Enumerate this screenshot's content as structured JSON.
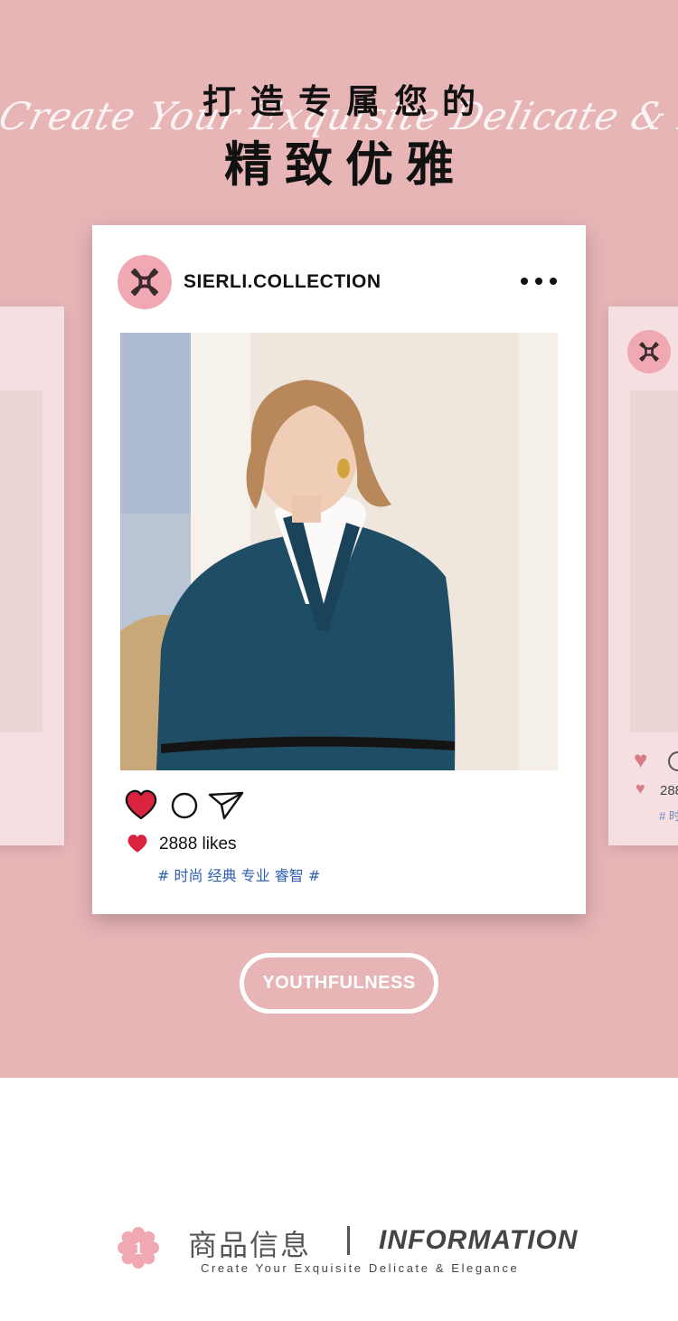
{
  "hero": {
    "script_text": "Create Your Exquisite Delicate & Elegance",
    "title_line1": "打造专属您的",
    "title_line2": "精致优雅",
    "background_color": "#e8b5b7"
  },
  "post": {
    "username": "SIERLI.COLLECTION",
    "more_icon": "ellipsis-icon",
    "photo_alt": "model in teal wool coat with black belt",
    "actions": {
      "like_icon": "heart-filled-icon",
      "comment_icon": "comment-circle-icon",
      "share_icon": "paper-plane-icon"
    },
    "likes_text": "2888 likes",
    "hashtags": "# 时尚 经典 专业 睿智 #",
    "like_color": "#d9233f",
    "hashtag_color": "#2d5fb0"
  },
  "ghost_card_right": {
    "likes_text": "288",
    "hashtag_text": "# 时"
  },
  "badge_button": {
    "label": "YOUTHFULNESS"
  },
  "section_header": {
    "number": "1",
    "title_zh": "商品信息",
    "title_en": "INFORMATION",
    "subtitle": "Create Your Exquisite Delicate & Elegance"
  }
}
